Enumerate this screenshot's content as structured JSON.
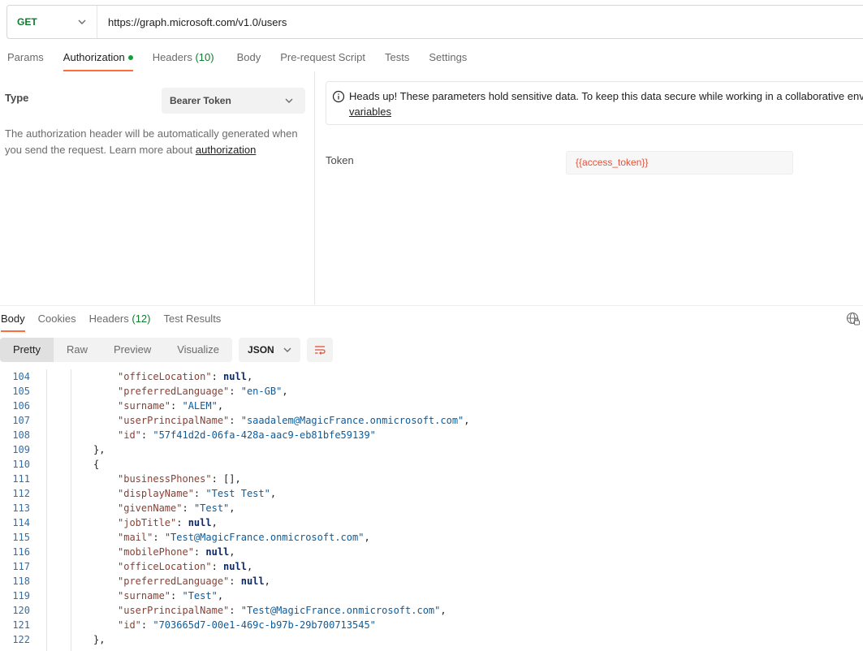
{
  "request": {
    "method": "GET",
    "url": "https://graph.microsoft.com/v1.0/users"
  },
  "request_tabs": [
    {
      "label": "Params"
    },
    {
      "label": "Authorization"
    },
    {
      "label": "Headers",
      "count": "(10)"
    },
    {
      "label": "Body"
    },
    {
      "label": "Pre-request Script"
    },
    {
      "label": "Tests"
    },
    {
      "label": "Settings"
    }
  ],
  "auth": {
    "type_label": "Type",
    "type_value": "Bearer Token",
    "description": "The authorization header will be automatically generated when you send the request. Learn more about ",
    "description_link": "authorization",
    "notice_text": "Heads up! These parameters hold sensitive data. To keep this data secure while working in a collaborative enviro",
    "notice_link": "variables",
    "token_label": "Token",
    "token_value": "{{access_token}}"
  },
  "response_tabs": [
    {
      "label": "Body"
    },
    {
      "label": "Cookies"
    },
    {
      "label": "Headers",
      "count": "(12)"
    },
    {
      "label": "Test Results"
    }
  ],
  "view_modes": [
    "Pretty",
    "Raw",
    "Preview",
    "Visualize"
  ],
  "format": "JSON",
  "code_lines": [
    {
      "n": "104",
      "depth": 2,
      "parts": [
        [
          "k",
          "\"officeLocation\""
        ],
        [
          "p",
          ": "
        ],
        [
          "nl",
          "null"
        ],
        [
          "p",
          ","
        ]
      ]
    },
    {
      "n": "105",
      "depth": 2,
      "parts": [
        [
          "k",
          "\"preferredLanguage\""
        ],
        [
          "p",
          ": "
        ],
        [
          "s",
          "\"en-GB\""
        ],
        [
          "p",
          ","
        ]
      ]
    },
    {
      "n": "106",
      "depth": 2,
      "parts": [
        [
          "k",
          "\"surname\""
        ],
        [
          "p",
          ": "
        ],
        [
          "s",
          "\"ALEM\""
        ],
        [
          "p",
          ","
        ]
      ]
    },
    {
      "n": "107",
      "depth": 2,
      "parts": [
        [
          "k",
          "\"userPrincipalName\""
        ],
        [
          "p",
          ": "
        ],
        [
          "s",
          "\"saadalem@MagicFrance.onmicrosoft.com\""
        ],
        [
          "p",
          ","
        ]
      ]
    },
    {
      "n": "108",
      "depth": 2,
      "parts": [
        [
          "k",
          "\"id\""
        ],
        [
          "p",
          ": "
        ],
        [
          "s",
          "\"57f41d2d-06fa-428a-aac9-eb81bfe59139\""
        ]
      ]
    },
    {
      "n": "109",
      "depth": 1,
      "parts": [
        [
          "p",
          "},"
        ]
      ]
    },
    {
      "n": "110",
      "depth": 1,
      "parts": [
        [
          "p",
          "{"
        ]
      ]
    },
    {
      "n": "111",
      "depth": 2,
      "parts": [
        [
          "k",
          "\"businessPhones\""
        ],
        [
          "p",
          ": [],"
        ]
      ]
    },
    {
      "n": "112",
      "depth": 2,
      "parts": [
        [
          "k",
          "\"displayName\""
        ],
        [
          "p",
          ": "
        ],
        [
          "s",
          "\"Test Test\""
        ],
        [
          "p",
          ","
        ]
      ]
    },
    {
      "n": "113",
      "depth": 2,
      "parts": [
        [
          "k",
          "\"givenName\""
        ],
        [
          "p",
          ": "
        ],
        [
          "s",
          "\"Test\""
        ],
        [
          "p",
          ","
        ]
      ]
    },
    {
      "n": "114",
      "depth": 2,
      "parts": [
        [
          "k",
          "\"jobTitle\""
        ],
        [
          "p",
          ": "
        ],
        [
          "nl",
          "null"
        ],
        [
          "p",
          ","
        ]
      ]
    },
    {
      "n": "115",
      "depth": 2,
      "parts": [
        [
          "k",
          "\"mail\""
        ],
        [
          "p",
          ": "
        ],
        [
          "s",
          "\"Test@MagicFrance.onmicrosoft.com\""
        ],
        [
          "p",
          ","
        ]
      ]
    },
    {
      "n": "116",
      "depth": 2,
      "parts": [
        [
          "k",
          "\"mobilePhone\""
        ],
        [
          "p",
          ": "
        ],
        [
          "nl",
          "null"
        ],
        [
          "p",
          ","
        ]
      ]
    },
    {
      "n": "117",
      "depth": 2,
      "parts": [
        [
          "k",
          "\"officeLocation\""
        ],
        [
          "p",
          ": "
        ],
        [
          "nl",
          "null"
        ],
        [
          "p",
          ","
        ]
      ]
    },
    {
      "n": "118",
      "depth": 2,
      "parts": [
        [
          "k",
          "\"preferredLanguage\""
        ],
        [
          "p",
          ": "
        ],
        [
          "nl",
          "null"
        ],
        [
          "p",
          ","
        ]
      ]
    },
    {
      "n": "119",
      "depth": 2,
      "parts": [
        [
          "k",
          "\"surname\""
        ],
        [
          "p",
          ": "
        ],
        [
          "s",
          "\"Test\""
        ],
        [
          "p",
          ","
        ]
      ]
    },
    {
      "n": "120",
      "depth": 2,
      "parts": [
        [
          "k",
          "\"userPrincipalName\""
        ],
        [
          "p",
          ": "
        ],
        [
          "s",
          "\"Test@MagicFrance.onmicrosoft.com\""
        ],
        [
          "p",
          ","
        ]
      ]
    },
    {
      "n": "121",
      "depth": 2,
      "parts": [
        [
          "k",
          "\"id\""
        ],
        [
          "p",
          ": "
        ],
        [
          "s",
          "\"703665d7-00e1-469c-b97b-29b700713545\""
        ]
      ]
    },
    {
      "n": "122",
      "depth": 1,
      "parts": [
        [
          "p",
          "},"
        ]
      ]
    }
  ],
  "colors": {
    "accent": "#ff6c37",
    "method_get": "#0f7b2d",
    "active_dot": "#0fa336",
    "token_var": "#e0533d",
    "line_numbers": "#2f6fae"
  }
}
